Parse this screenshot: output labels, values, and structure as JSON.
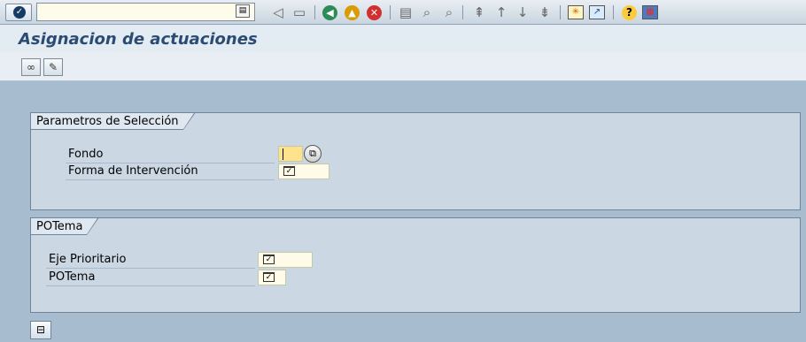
{
  "toolbar": {
    "command_field_value": "",
    "icons": [
      "enter-icon",
      "back-arrow-icon",
      "save-icon",
      "back-icon",
      "exit-icon",
      "cancel-icon",
      "print-icon",
      "find-icon",
      "find-next-icon",
      "first-page-icon",
      "previous-page-icon",
      "next-page-icon",
      "last-page-icon",
      "create-session-icon",
      "shortcut-icon",
      "help-icon",
      "layout-icon"
    ]
  },
  "title": "Asignacion de actuaciones",
  "app_toolbar": {
    "display_icon": "glasses-icon",
    "change_icon": "pencil-icon"
  },
  "group1": {
    "title": "Parametros de Selección",
    "rows": [
      {
        "label": "Fondo",
        "value": ""
      },
      {
        "label": "Forma de Intervención",
        "value": ""
      }
    ]
  },
  "group2": {
    "title": "POTema",
    "rows": [
      {
        "label": "Eje Prioritario",
        "value": ""
      },
      {
        "label": "POTema",
        "value": ""
      }
    ]
  },
  "colors": {
    "title": "#2b4b73",
    "background": "#a7bccf",
    "group": "#cbd8e4",
    "required_field": "#ffe38c"
  }
}
